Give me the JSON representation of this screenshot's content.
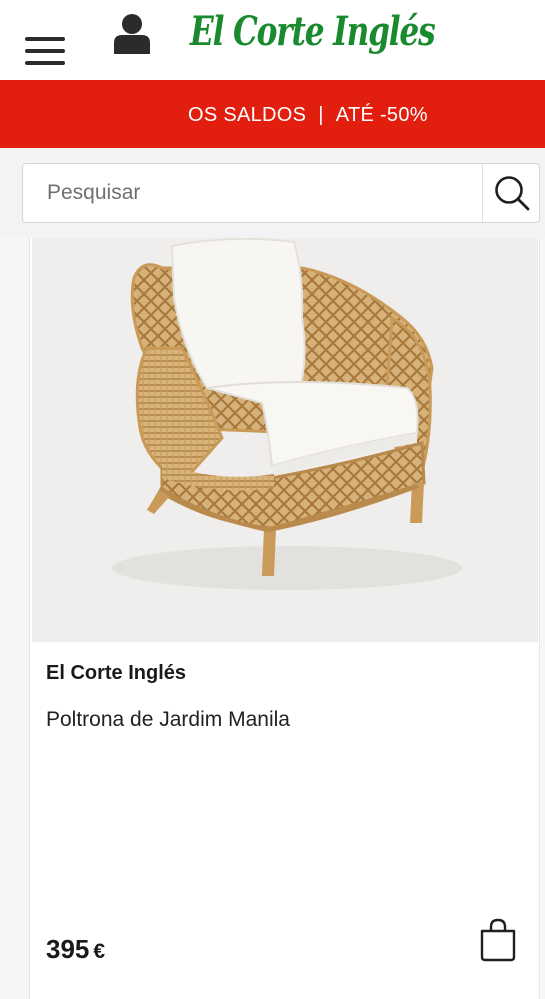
{
  "header": {
    "logo_text": "El Corte Inglés",
    "menu_icon": "hamburger-menu-icon",
    "account_icon": "user-account-icon"
  },
  "promo": {
    "left": "OS SALDOS",
    "separator": "|",
    "right": "ATÉ -50%",
    "color": "#e21f0f"
  },
  "search": {
    "placeholder": "Pesquisar",
    "value": "",
    "icon": "search-icon"
  },
  "product": {
    "image_alt": "rattan-armchair-with-white-cushions",
    "brand": "El Corte Inglés",
    "name": "Poltrona de Jardim Manila",
    "price": "395",
    "currency": "€",
    "cart_icon": "shopping-bag-icon"
  },
  "colors": {
    "brand_green": "#1a8a2e",
    "banner_red": "#e21f0f",
    "text_dark": "#1a1a1a"
  }
}
